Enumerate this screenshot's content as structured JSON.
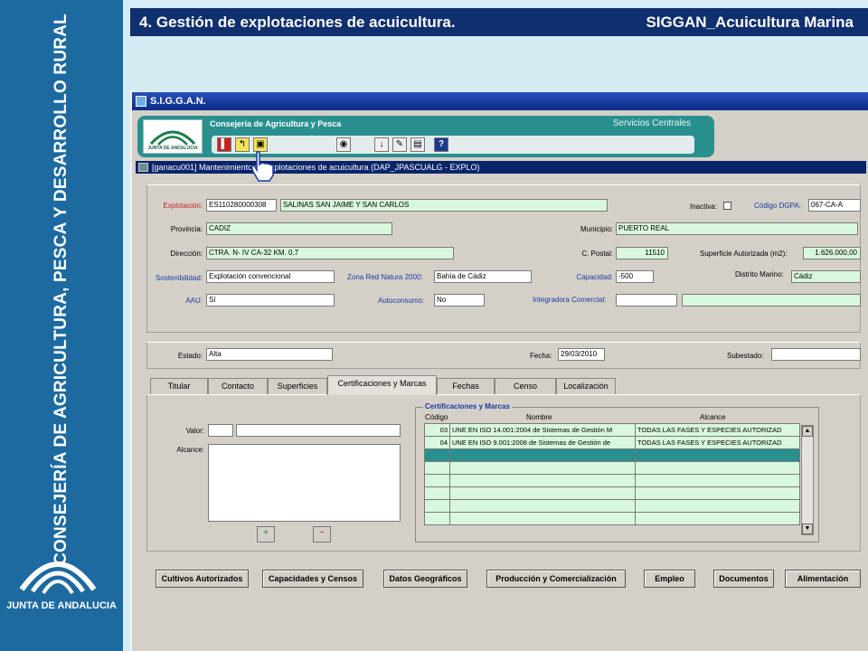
{
  "side": {
    "line1": "CONSEJERÍA DE AGRICULTURA, PESCA Y DESARROLLO RURAL",
    "junta": "JUNTA DE ANDALUCIA"
  },
  "header": {
    "title": "4. Gestión de explotaciones de acuicultura.",
    "app": "SIGGAN_Acuicultura Marina"
  },
  "window": {
    "title": "S.I.G.G.A.N.",
    "consejeria": "Consejería de Agricultura y Pesca",
    "servicios": "Servicios Centrales",
    "logo_text": "JUNTA DE ANDALUCIA",
    "subtitle": "[ganacu001] Mantenimiento de explotaciones de acuicultura  (DAP_JPASCUALG - EXPLO)"
  },
  "form": {
    "explotacion_label": "Explotación:",
    "explotacion_code": "ES110280000308",
    "explotacion_name": "SALINAS SAN JAIME Y SAN CARLOS",
    "inactiva_label": "Inactiva:",
    "dgpa_label": "Código DGPA:",
    "dgpa": "067-CA-A",
    "provincia_label": "Provincia:",
    "provincia": "CADIZ",
    "municipio_label": "Municipio:",
    "municipio": "PUERTO REAL",
    "direccion_label": "Dirección:",
    "direccion": "CTRA. N- IV CA-32 KM. 0.7",
    "cpostal_label": "C. Postal:",
    "cpostal": "11510",
    "superficie_label": "Superficie Autorizada (m2):",
    "superficie": "1.626.000,00",
    "sostenibilidad_label": "Sostenibilidad:",
    "sostenibilidad": "Explotación convencional",
    "natura_label": "Zona Red Natura 2000:",
    "natura": "Bahía de Cádiz",
    "capacidad_label": "Capacidad:",
    "capacidad": "-500",
    "distrito_label": "Distrito Marino:",
    "distrito": "Cádiz",
    "aau_label": "AAU:",
    "aau": "Sí",
    "autoconsumo_label": "Autoconsumo:",
    "autoconsumo": "No",
    "integradora_label": "Integradora Comercial:",
    "estado_label": "Estado:",
    "estado": "Alta",
    "fecha_label": "Fecha:",
    "fecha": "29/03/2010",
    "subestado_label": "Subestado:"
  },
  "tabs": [
    "Titular",
    "Contacto",
    "Superficies",
    "Certificaciones y Marcas",
    "Fechas",
    "Censo",
    "Localización"
  ],
  "cert": {
    "valor_label": "Valor:",
    "alcance_label": "Alcance:",
    "group_title": "Certificaciones y Marcas",
    "headers": [
      "Código",
      "Nombre",
      "Alcance"
    ],
    "rows": [
      {
        "codigo": "03",
        "nombre": "UNE EN ISO 14.001:2004 de Sistemas de Gestión M",
        "alcance": "TODAS LAS FASES Y ESPECIES AUTORIZAD"
      },
      {
        "codigo": "04",
        "nombre": "UNE EN ISO 9.001:2008 de Sistemas de Gestión de",
        "alcance": "TODAS LAS FASES Y ESPECIES AUTORIZAD"
      }
    ]
  },
  "buttons": [
    "Cultivos Autorizados",
    "Capacidades y Censos",
    "Datos Geográficos",
    "Producción y Comercialización",
    "Empleo",
    "Documentos",
    "Alimentación"
  ],
  "colors": {
    "side": "#1c6aa0",
    "header": "#0f2f6f",
    "appbar": "#2a8f8f",
    "field_green": "#d9f7dc"
  }
}
